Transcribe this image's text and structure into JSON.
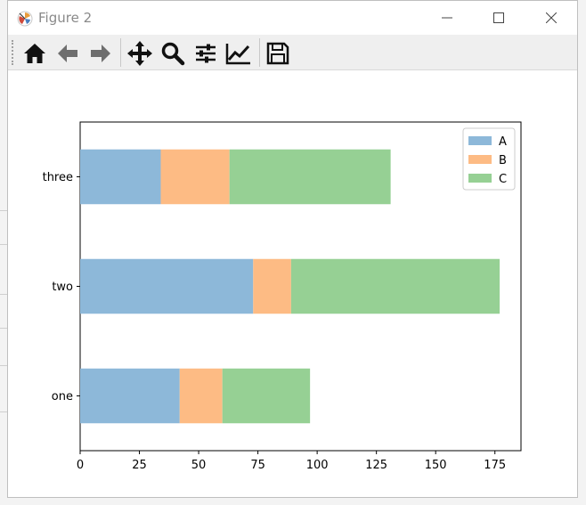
{
  "window": {
    "title": "Figure 2"
  },
  "toolbar": {
    "buttons": [
      {
        "name": "home-button",
        "icon": "home-icon"
      },
      {
        "name": "back-button",
        "icon": "arrow-left-icon"
      },
      {
        "name": "forward-button",
        "icon": "arrow-right-icon"
      },
      {
        "name": "pan-button",
        "icon": "move-icon"
      },
      {
        "name": "zoom-button",
        "icon": "magnifier-icon"
      },
      {
        "name": "configure-subplots-button",
        "icon": "sliders-icon"
      },
      {
        "name": "edit-axes-button",
        "icon": "line-chart-icon"
      },
      {
        "name": "save-button",
        "icon": "floppy-disk-icon"
      }
    ]
  },
  "colors": {
    "A": "#8db8d9",
    "B": "#fdbb84",
    "C": "#96d094"
  },
  "chart_data": {
    "type": "bar",
    "orientation": "horizontal",
    "stacked": true,
    "categories": [
      "one",
      "two",
      "three"
    ],
    "series": [
      {
        "name": "A",
        "values": [
          42,
          73,
          34
        ]
      },
      {
        "name": "B",
        "values": [
          18,
          16,
          29
        ]
      },
      {
        "name": "C",
        "values": [
          37,
          88,
          68
        ]
      }
    ],
    "xticks": [
      "0",
      "25",
      "50",
      "75",
      "100",
      "125",
      "150",
      "175"
    ],
    "xlim": [
      0,
      186
    ],
    "title": "",
    "xlabel": "",
    "ylabel": "",
    "legend": "top-right",
    "grid": false
  }
}
